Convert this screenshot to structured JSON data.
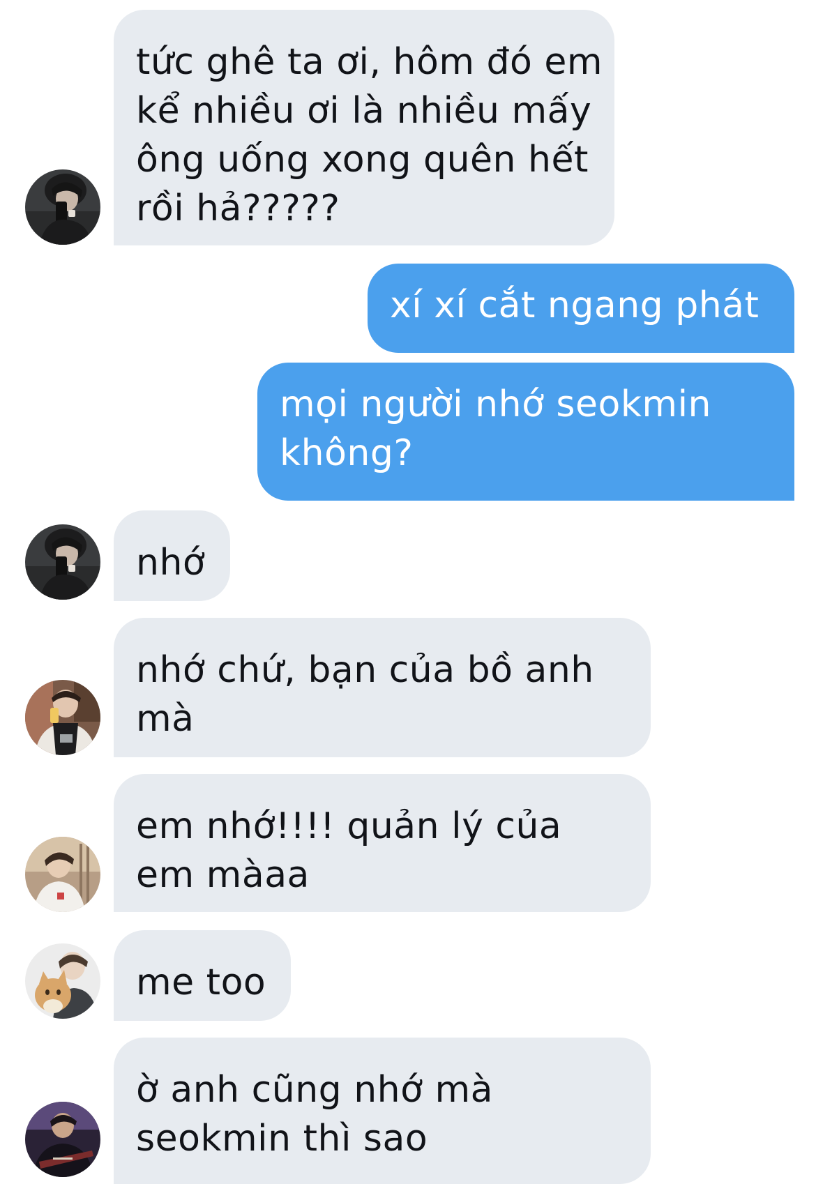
{
  "messages": [
    {
      "direction": "incoming",
      "avatar": "person-holding-phone-selfie",
      "lines": [
        "tức ghê ta ơi, hôm đó em",
        "kể nhiều ơi là nhiều mấy",
        "ông uống xong quên hết",
        "rồi hả?????"
      ]
    },
    {
      "direction": "outgoing",
      "lines": [
        "xí xí cắt ngang phát"
      ]
    },
    {
      "direction": "outgoing",
      "lines": [
        "mọi người nhớ seokmin",
        "không?"
      ]
    },
    {
      "direction": "incoming",
      "avatar": "person-holding-phone-selfie",
      "lines": [
        "nhớ"
      ]
    },
    {
      "direction": "incoming",
      "avatar": "person-drinking-in-apron",
      "lines": [
        "nhớ chứ, bạn của bồ anh",
        "mà"
      ]
    },
    {
      "direction": "incoming",
      "avatar": "person-in-light-room",
      "lines": [
        "em nhớ!!!! quản lý của",
        "em màaa"
      ]
    },
    {
      "direction": "incoming",
      "avatar": "person-holding-cat",
      "lines": [
        "me too"
      ]
    },
    {
      "direction": "incoming",
      "avatar": "person-with-guitar",
      "lines": [
        "ờ anh cũng nhớ mà",
        "seokmin thì sao"
      ]
    }
  ],
  "colors": {
    "incoming_bubble": "#e7ebf0",
    "incoming_text": "#111318",
    "outgoing_bubble": "#4ba0ed",
    "outgoing_text": "#ffffff",
    "background": "#ffffff"
  }
}
